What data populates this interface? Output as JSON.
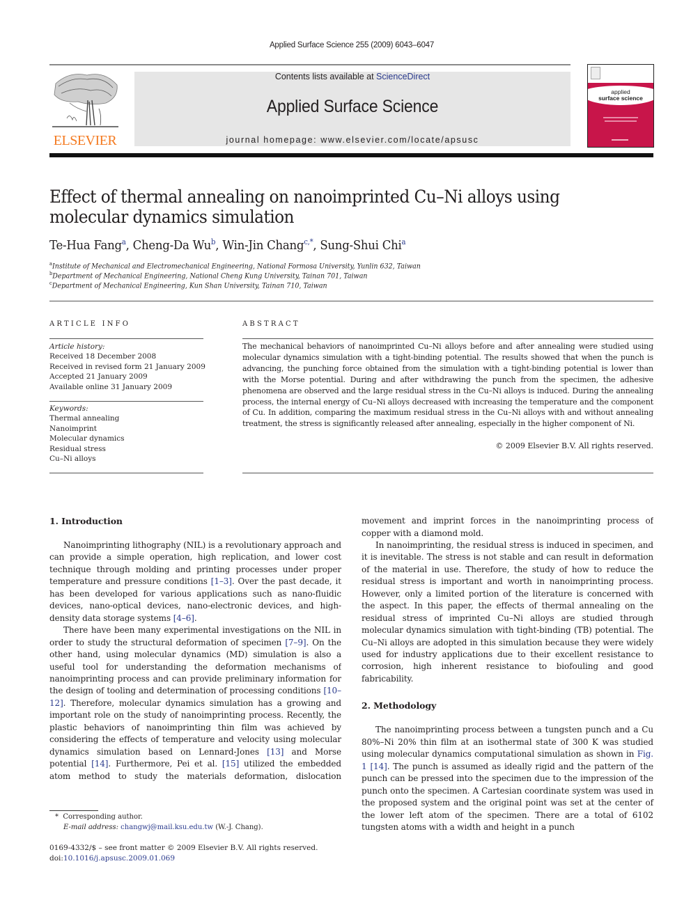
{
  "header": {
    "running_head": "Applied Surface Science 255 (2009) 6043–6047",
    "contents_prefix": "Contents lists available at ",
    "contents_link": "ScienceDirect",
    "journal_name": "Applied Surface Science",
    "homepage": "journal homepage: www.elsevier.com/locate/apsusc",
    "publisher_logo_text": "ELSEVIER",
    "cover_title_line1": "applied",
    "cover_title_line2": "surface science"
  },
  "colors": {
    "link": "#2a3a8c",
    "elsevier_orange": "#f47a20",
    "cover_magenta": "#c8154a",
    "banner_gray": "#e6e6e6"
  },
  "article": {
    "title": "Effect of thermal annealing on nanoimprinted Cu–Ni alloys using molecular dynamics simulation",
    "authors": [
      {
        "name": "Te-Hua Fang",
        "sup": "a"
      },
      {
        "name": "Cheng-Da Wu",
        "sup": "b"
      },
      {
        "name": "Win-Jin Chang",
        "sup": "c,*"
      },
      {
        "name": "Sung-Shui Chi",
        "sup": "a"
      }
    ],
    "affiliations": [
      {
        "sup": "a",
        "text": "Institute of Mechanical and Electromechanical Engineering, National Formosa University, Yunlin 632, Taiwan"
      },
      {
        "sup": "b",
        "text": "Department of Mechanical Engineering, National Cheng Kung University, Tainan 701, Taiwan"
      },
      {
        "sup": "c",
        "text": "Department of Mechanical Engineering, Kun Shan University, Tainan 710, Taiwan"
      }
    ]
  },
  "article_info": {
    "heading": "ARTICLE INFO",
    "history_label": "Article history:",
    "history": [
      "Received 18 December 2008",
      "Received in revised form 21 January 2009",
      "Accepted 21 January 2009",
      "Available online 31 January 2009"
    ],
    "keywords_label": "Keywords:",
    "keywords": [
      "Thermal annealing",
      "Nanoimprint",
      "Molecular dynamics",
      "Residual stress",
      "Cu–Ni alloys"
    ]
  },
  "abstract": {
    "heading": "ABSTRACT",
    "text": "The mechanical behaviors of nanoimprinted Cu–Ni alloys before and after annealing were studied using molecular dynamics simulation with a tight-binding potential. The results showed that when the punch is advancing, the punching force obtained from the simulation with a tight-binding potential is lower than with the Morse potential. During and after withdrawing the punch from the specimen, the adhesive phenomena are observed and the large residual stress in the Cu–Ni alloys is induced. During the annealing process, the internal energy of Cu–Ni alloys decreased with increasing the temperature and the component of Cu. In addition, comparing the maximum residual stress in the Cu–Ni alloys with and without annealing treatment, the stress is significantly released after annealing, especially in the higher component of Ni.",
    "copyright": "© 2009 Elsevier B.V. All rights reserved."
  },
  "body": {
    "sec1_heading": "1.  Introduction",
    "sec1_p1": [
      {
        "t": "Nanoimprinting lithography (NIL) is a revolutionary approach and can provide a simple operation, high replication, and lower cost technique through molding and printing processes under proper temperature and pressure conditions "
      },
      {
        "ref": "[1–3]"
      },
      {
        "t": ". Over the past decade, it has been developed for various applications such as nano-fluidic devices, nano-optical devices, nano-electronic devices, and high-density data storage systems "
      },
      {
        "ref": "[4–6]"
      },
      {
        "t": "."
      }
    ],
    "sec1_p2": [
      {
        "t": "There have been many experimental investigations on the NIL in order to study the structural deformation of specimen "
      },
      {
        "ref": "[7–9]"
      },
      {
        "t": ". On the other hand, using molecular dynamics (MD) simulation is also a useful tool for understanding the deformation mechanisms of nanoimprinting process and can provide preliminary information for the design of tooling and determination of processing conditions "
      },
      {
        "ref": "[10–12]"
      },
      {
        "t": ". Therefore, molecular dynamics simulation has a growing and important role on the study of nanoimprinting process. Recently, the plastic behaviors of nanoimprinting thin film was achieved by considering the effects of temperature and velocity using molecular dynamics simulation based on Lennard-Jones "
      },
      {
        "ref": "[13]"
      },
      {
        "t": " and Morse potential "
      },
      {
        "ref": "[14]"
      },
      {
        "t": ". Furthermore, Pei et al. "
      },
      {
        "ref": "[15]"
      },
      {
        "t": " utilized the embedded atom method to study the materials deformation, dislocation movement and imprint forces in the nanoimprinting process of copper with a diamond mold."
      }
    ],
    "sec1_p3": "In nanoimprinting, the residual stress is induced in specimen, and it is inevitable. The stress is not stable and can result in deformation of the material in use. Therefore, the study of how to reduce the residual stress is important and worth in nanoimprinting process. However, only a limited portion of the literature is concerned with the aspect. In this paper, the effects of thermal annealing on the residual stress of imprinted Cu–Ni alloys are studied through molecular dynamics simulation with tight-binding (TB) potential. The Cu–Ni alloys are adopted in this simulation because they were widely used for industry applications due to their excellent resistance to corrosion, high inherent resistance to biofouling and good fabricability.",
    "sec2_heading": "2.  Methodology",
    "sec2_p1": [
      {
        "t": "The nanoimprinting process between a tungsten punch and a Cu 80%–Ni 20% thin film at an isothermal state of 300 K was studied using molecular dynamics computational simulation as shown in "
      },
      {
        "ref": "Fig. 1"
      },
      {
        "t": " "
      },
      {
        "ref": "[14]"
      },
      {
        "t": ". The punch is assumed as ideally rigid and the pattern of the punch can be pressed into the specimen due to the impression of the punch onto the specimen. A Cartesian coordinate system was used in the proposed system and the original point was set at the center of the lower left atom of the specimen. There are a total of 6102 tungsten atoms with a width and height in a punch"
      }
    ]
  },
  "footnote": {
    "marker": "*",
    "corresponding": "Corresponding author.",
    "email_label": "E-mail address: ",
    "email": "changwj@mail.ksu.edu.tw",
    "email_suffix": " (W.-J. Chang)."
  },
  "front_matter": {
    "issn_line": "0169-4332/$ – see front matter © 2009 Elsevier B.V. All rights reserved.",
    "doi_prefix": "doi:",
    "doi": "10.1016/j.apsusc.2009.01.069"
  }
}
